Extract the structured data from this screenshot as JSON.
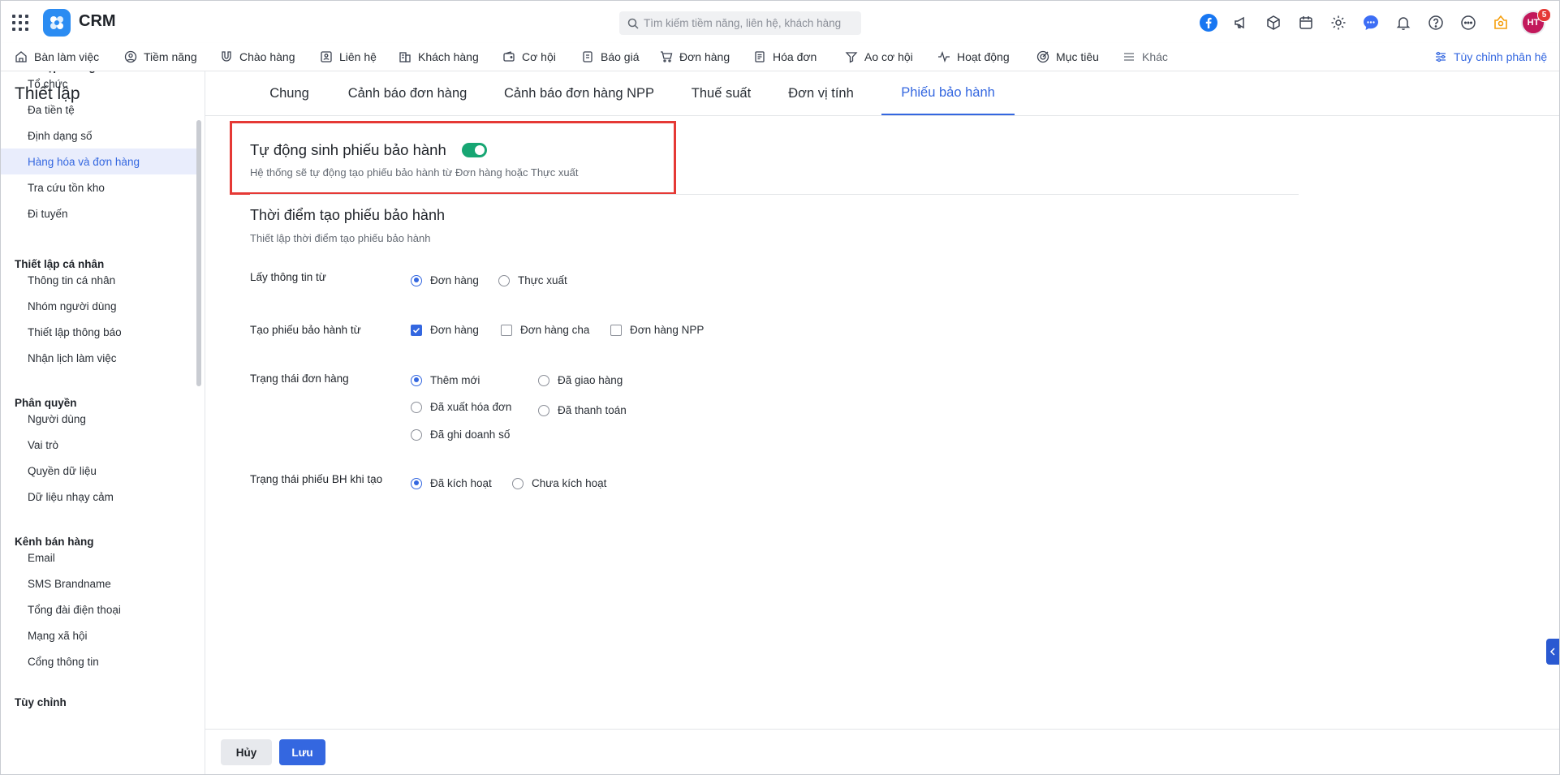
{
  "app": {
    "title": "CRM",
    "search_placeholder": "Tìm kiếm tiềm năng, liên hệ, khách hàng",
    "avatar_initials": "HT",
    "notification_count": "5"
  },
  "nav": {
    "items": [
      {
        "label": "Bàn làm việc",
        "icon": "home-icon"
      },
      {
        "label": "Tiềm năng",
        "icon": "user-circle-icon"
      },
      {
        "label": "Chào hàng",
        "icon": "magnet-icon"
      },
      {
        "label": "Liên hệ",
        "icon": "contact-card-icon"
      },
      {
        "label": "Khách hàng",
        "icon": "building-icon"
      },
      {
        "label": "Cơ hội",
        "icon": "wallet-icon"
      },
      {
        "label": "Báo giá",
        "icon": "quote-doc-icon"
      },
      {
        "label": "Đơn hàng",
        "icon": "cart-icon"
      },
      {
        "label": "Hóa đơn",
        "icon": "invoice-icon"
      },
      {
        "label": "Ao cơ hội",
        "icon": "funnel-icon"
      },
      {
        "label": "Hoạt động",
        "icon": "activity-icon"
      },
      {
        "label": "Mục tiêu",
        "icon": "target-icon"
      },
      {
        "label": "Khác",
        "icon": "menu-icon"
      }
    ],
    "customize_label": "Tùy chỉnh phân hệ"
  },
  "sidebar": {
    "title": "Thiết lập",
    "sections": [
      {
        "title": "Thiết lập chung",
        "items": [
          "Tổ chức",
          "Đa tiền tệ",
          "Định dạng số",
          "Hàng hóa và đơn hàng",
          "Tra cứu tồn kho",
          "Đi tuyến"
        ]
      },
      {
        "title": "Thiết lập cá nhân",
        "items": [
          "Thông tin cá nhân",
          "Nhóm người dùng",
          "Thiết lập thông báo",
          "Nhận lịch làm việc"
        ]
      },
      {
        "title": "Phân quyền",
        "items": [
          "Người dùng",
          "Vai trò",
          "Quyền dữ liệu",
          "Dữ liệu nhạy cảm"
        ]
      },
      {
        "title": "Kênh bán hàng",
        "items": [
          "Email",
          "SMS Brandname",
          "Tổng đài điện thoại",
          "Mạng xã hội",
          "Cổng thông tin"
        ]
      },
      {
        "title": "Tùy chỉnh",
        "items": []
      }
    ],
    "active_item": "Hàng hóa và đơn hàng"
  },
  "tabs": [
    "Chung",
    "Cảnh báo đơn hàng",
    "Cảnh báo đơn hàng NPP",
    "Thuế suất",
    "Đơn vị tính",
    "Phiếu bảo hành"
  ],
  "active_tab": "Phiếu bảo hành",
  "auto_gen": {
    "title": "Tự động sinh phiếu bảo hành",
    "enabled": true,
    "description": "Hệ thống sẽ tự động tạo phiếu bảo hành từ Đơn hàng hoặc Thực xuất"
  },
  "timing": {
    "title": "Thời điểm tạo phiếu bảo hành",
    "description": "Thiết lập thời điểm tạo phiếu bảo hành"
  },
  "fields": {
    "source": {
      "label": "Lấy thông tin từ",
      "options": [
        {
          "label": "Đơn hàng",
          "selected": true
        },
        {
          "label": "Thực xuất",
          "selected": false
        }
      ]
    },
    "create_from": {
      "label": "Tạo phiếu bảo hành từ",
      "options": [
        {
          "label": "Đơn hàng",
          "checked": true
        },
        {
          "label": "Đơn hàng cha",
          "checked": false
        },
        {
          "label": "Đơn hàng NPP",
          "checked": false
        }
      ]
    },
    "order_status": {
      "label": "Trạng thái đơn hàng",
      "options": [
        {
          "label": "Thêm mới",
          "selected": true
        },
        {
          "label": "Đã giao hàng",
          "selected": false
        },
        {
          "label": "Đã xuất hóa đơn",
          "selected": false
        },
        {
          "label": "Đã thanh toán",
          "selected": false
        },
        {
          "label": "Đã ghi doanh số",
          "selected": false
        }
      ]
    },
    "warranty_status": {
      "label": "Trạng thái phiếu BH khi tạo",
      "options": [
        {
          "label": "Đã kích hoạt",
          "selected": true
        },
        {
          "label": "Chưa kích hoạt",
          "selected": false
        }
      ]
    }
  },
  "footer": {
    "cancel_label": "Hủy",
    "save_label": "Lưu"
  },
  "colors": {
    "accent": "#3467e0",
    "toggle_on": "#17a673",
    "highlight": "#e53935"
  }
}
